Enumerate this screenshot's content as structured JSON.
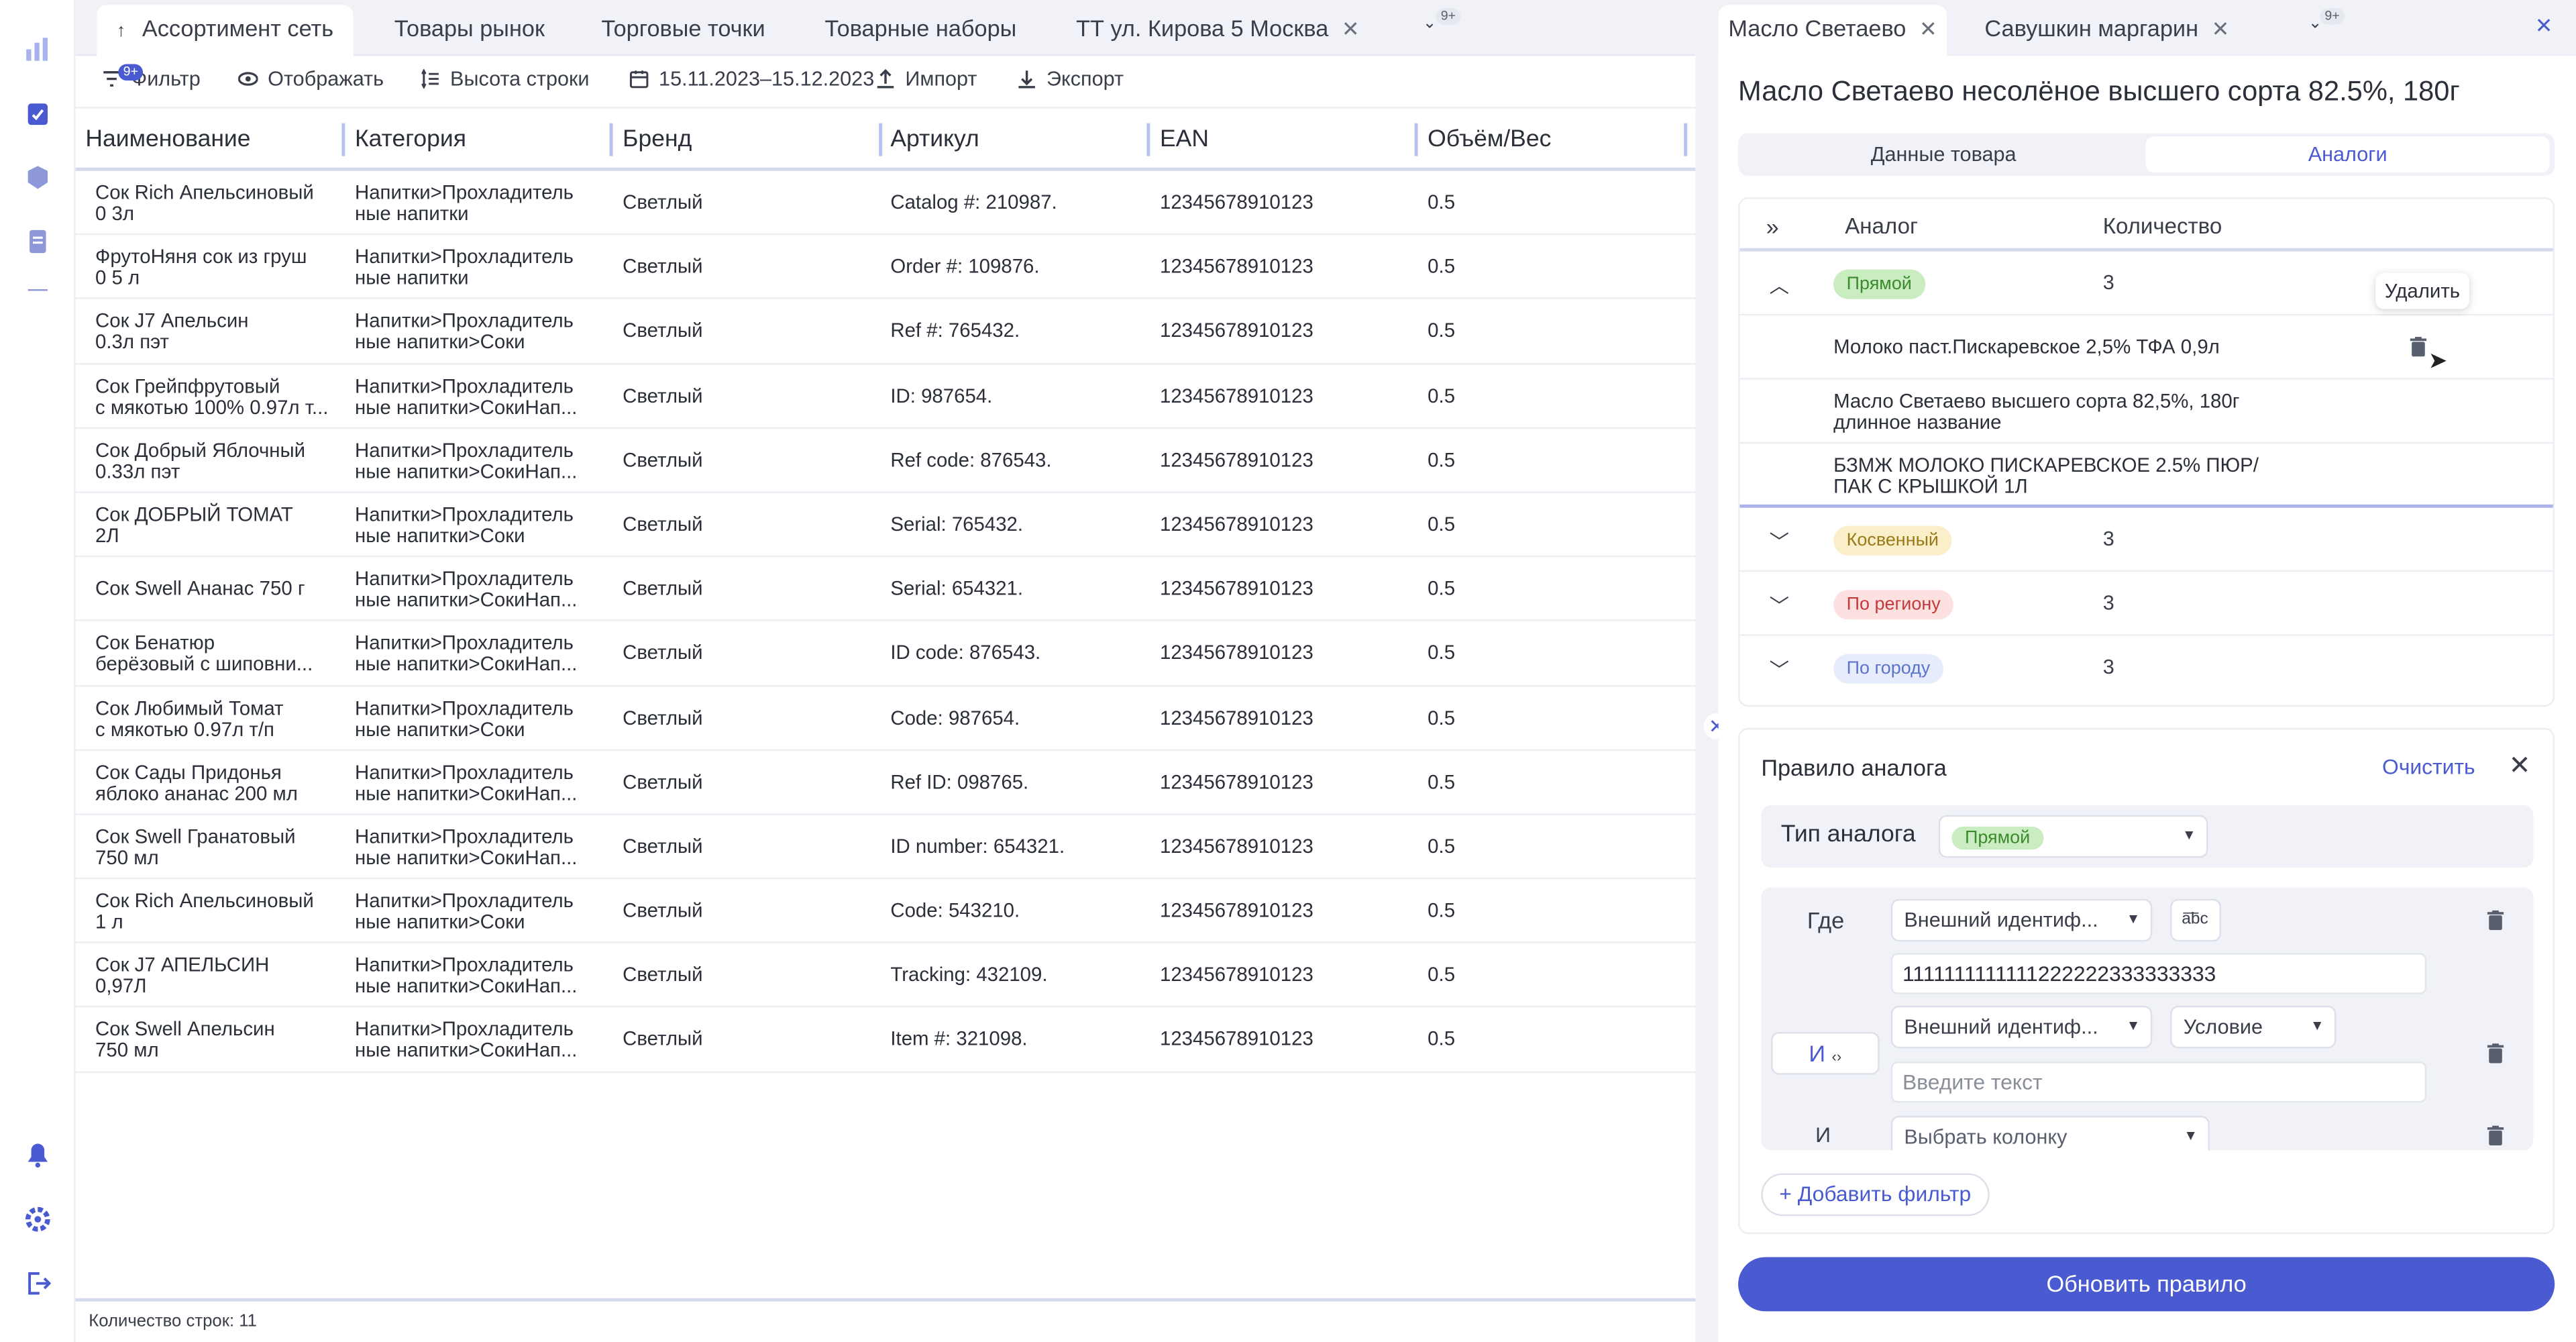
{
  "left_tabs": [
    {
      "label": "Ассортимент сеть"
    },
    {
      "label": "Товары рынок"
    },
    {
      "label": "Торговые точки"
    },
    {
      "label": "Товарные наборы"
    },
    {
      "label": "ТТ ул. Кирова 5 Москва"
    }
  ],
  "overflow_badge": "9+",
  "toolbar": {
    "filter": "Фильтр",
    "filter_badge": "9+",
    "display": "Отображать",
    "row_height": "Высота строки",
    "date_range": "15.11.2023–15.12.2023",
    "import": "Импорт",
    "export": "Экспорт"
  },
  "columns": [
    "Наименование",
    "Категория",
    "Бренд",
    "Артикул",
    "EAN",
    "Объём/Вес"
  ],
  "rows": [
    {
      "name1": "Сок Rich Апельсиновый",
      "name2": "0 3л",
      "cat1": "Напитки>Прохладитель",
      "cat2": "ные напитки",
      "brand": "Светлый",
      "article": "Catalog #: 210987.",
      "ean": "12345678910123",
      "vol": "0.5"
    },
    {
      "name1": "ФрутоНяня сок из груш",
      "name2": "0 5 л",
      "cat1": "Напитки>Прохладитель",
      "cat2": "ные напитки",
      "brand": "Светлый",
      "article": "Order #: 109876.",
      "ean": "12345678910123",
      "vol": "0.5"
    },
    {
      "name1": "Сок J7 Апельсин",
      "name2": "0.3л пэт",
      "cat1": "Напитки>Прохладитель",
      "cat2": "ные напитки>Соки",
      "brand": "Светлый",
      "article": "Ref #: 765432.",
      "ean": "12345678910123",
      "vol": "0.5"
    },
    {
      "name1": "Сок Грейпфрутовый",
      "name2": "с мякотью 100% 0.97л т...",
      "cat1": "Напитки>Прохладитель",
      "cat2": "ные напитки>СокиНап...",
      "brand": "Светлый",
      "article": "ID: 987654.",
      "ean": "12345678910123",
      "vol": "0.5"
    },
    {
      "name1": "Сок Добрый Яблочный",
      "name2": "0.33л пэт",
      "cat1": "Напитки>Прохладитель",
      "cat2": "ные напитки>СокиНап...",
      "brand": "Светлый",
      "article": "Ref code: 876543.",
      "ean": "12345678910123",
      "vol": "0.5"
    },
    {
      "name1": "Сок ДОБРЫЙ ТОМАТ",
      "name2": "2Л",
      "cat1": "Напитки>Прохладитель",
      "cat2": "ные напитки>Соки",
      "brand": "Светлый",
      "article": "Serial: 765432.",
      "ean": "12345678910123",
      "vol": "0.5"
    },
    {
      "name1": "Сок Swell Ананас 750 г",
      "name2": "",
      "cat1": "Напитки>Прохладитель",
      "cat2": "ные напитки>СокиНап...",
      "brand": "Светлый",
      "article": "Serial: 654321.",
      "ean": "12345678910123",
      "vol": "0.5"
    },
    {
      "name1": "Сок Бенатюр",
      "name2": "берёзовый с шиповни...",
      "cat1": "Напитки>Прохладитель",
      "cat2": "ные напитки>СокиНап...",
      "brand": "Светлый",
      "article": "ID code: 876543.",
      "ean": "12345678910123",
      "vol": "0.5"
    },
    {
      "name1": "Сок Любимый Томат",
      "name2": "с мякотью 0.97л т/п",
      "cat1": "Напитки>Прохладитель",
      "cat2": "ные напитки>Соки",
      "brand": "Светлый",
      "article": "Code: 987654.",
      "ean": "12345678910123",
      "vol": "0.5"
    },
    {
      "name1": "Сок Сады Придонья",
      "name2": "яблоко ананас 200 мл",
      "cat1": "Напитки>Прохладитель",
      "cat2": "ные напитки>СокиНап...",
      "brand": "Светлый",
      "article": "Ref ID: 098765.",
      "ean": "12345678910123",
      "vol": "0.5"
    },
    {
      "name1": "Сок Swell Гранатовый",
      "name2": "750 мл",
      "cat1": "Напитки>Прохладитель",
      "cat2": "ные напитки>СокиНап...",
      "brand": "Светлый",
      "article": "ID number: 654321.",
      "ean": "12345678910123",
      "vol": "0.5"
    },
    {
      "name1": "Сок Rich Апельсиновый",
      "name2": "1 л",
      "cat1": "Напитки>Прохладитель",
      "cat2": "ные напитки>Соки",
      "brand": "Светлый",
      "article": "Code: 543210.",
      "ean": "12345678910123",
      "vol": "0.5"
    },
    {
      "name1": "Сок J7 АПЕЛЬСИН",
      "name2": "0,97Л",
      "cat1": "Напитки>Прохладитель",
      "cat2": "ные напитки>СокиНап...",
      "brand": "Светлый",
      "article": "Tracking: 432109.",
      "ean": "12345678910123",
      "vol": "0.5"
    },
    {
      "name1": "Сок Swell Апельсин",
      "name2": "750 мл",
      "cat1": "Напитки>Прохладитель",
      "cat2": "ные напитки>СокиНап...",
      "brand": "Светлый",
      "article": "Item #: 321098.",
      "ean": "12345678910123",
      "vol": "0.5"
    }
  ],
  "footer": "Количество строк: 11",
  "right_tabs": [
    {
      "label": "Масло Светаево"
    },
    {
      "label": "Савушкин маргарин"
    }
  ],
  "product_title": "Масло Светаево несолёное высшего сорта 82.5%, 180г",
  "segment": {
    "data": "Данные товара",
    "analogs": "Аналоги"
  },
  "analog_table": {
    "col_analog": "Аналог",
    "col_qty": "Количество",
    "groups": [
      {
        "label": "Прямой",
        "qty": "3",
        "bg": "#c9ecc0",
        "fg": "#3c8a2e"
      },
      {
        "label": "Косвенный",
        "qty": "3",
        "bg": "#fbefc9",
        "fg": "#9a7a18"
      },
      {
        "label": "По региону",
        "qty": "3",
        "bg": "#fde1e1",
        "fg": "#c23a3a"
      },
      {
        "label": "По городу",
        "qty": "3",
        "bg": "#e6ecfb",
        "fg": "#5b73c9"
      }
    ],
    "sub_items": [
      {
        "l1": "Молоко паст.Пискаревское 2,5% ТФА 0,9л",
        "l2": ""
      },
      {
        "l1": "Масло Светаево высшего сорта 82,5%, 180г",
        "l2": "длинное название"
      },
      {
        "l1": "БЗМЖ МОЛОКО ПИСКАРЕВСКОЕ 2.5% ПЮР/",
        "l2": "ПАК С КРЫШКОЙ 1Л"
      }
    ]
  },
  "tooltip": "Удалить",
  "rule": {
    "title": "Правило аналога",
    "clear": "Очистить",
    "type_label": "Тип аналога",
    "type_value": "Прямой",
    "where": "Где",
    "and": "И",
    "col_select_1": "Внешний идентиф...",
    "abc": "a͞bc",
    "value_1": "1111111111111222222333333333",
    "col_select_2": "Внешний идентиф...",
    "condition": "Условие",
    "text_placeholder": "Введите текст",
    "col_select_3": "Выбрать колонку",
    "add_filter": "+ Добавить фильтр"
  },
  "update_button": "Обновить правило"
}
